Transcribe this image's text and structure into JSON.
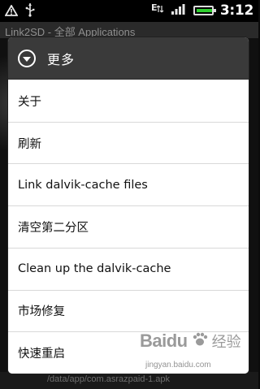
{
  "status_bar": {
    "time": "3:12",
    "icons": [
      "warning-icon",
      "usb-icon",
      "data-e-icon",
      "signal-icon",
      "battery-icon"
    ],
    "battery_color": "#2fcf2f"
  },
  "app": {
    "title": "Link2SD - 全部 Applications",
    "bottom_path": "/data/app/com.asrazpaid-1.apk"
  },
  "menu": {
    "title": "更多",
    "header_icon": "chevron-circle-down-icon",
    "items": [
      {
        "label": "关于"
      },
      {
        "label": "刷新"
      },
      {
        "label": "Link dalvik-cache files"
      },
      {
        "label": "清空第二分区"
      },
      {
        "label": "Clean up the dalvik-cache"
      },
      {
        "label": "市场修复"
      },
      {
        "label": "快速重启"
      }
    ]
  },
  "watermark": {
    "logo": "Baidu",
    "cn": "经验",
    "site": "jingyan.baidu.com"
  }
}
